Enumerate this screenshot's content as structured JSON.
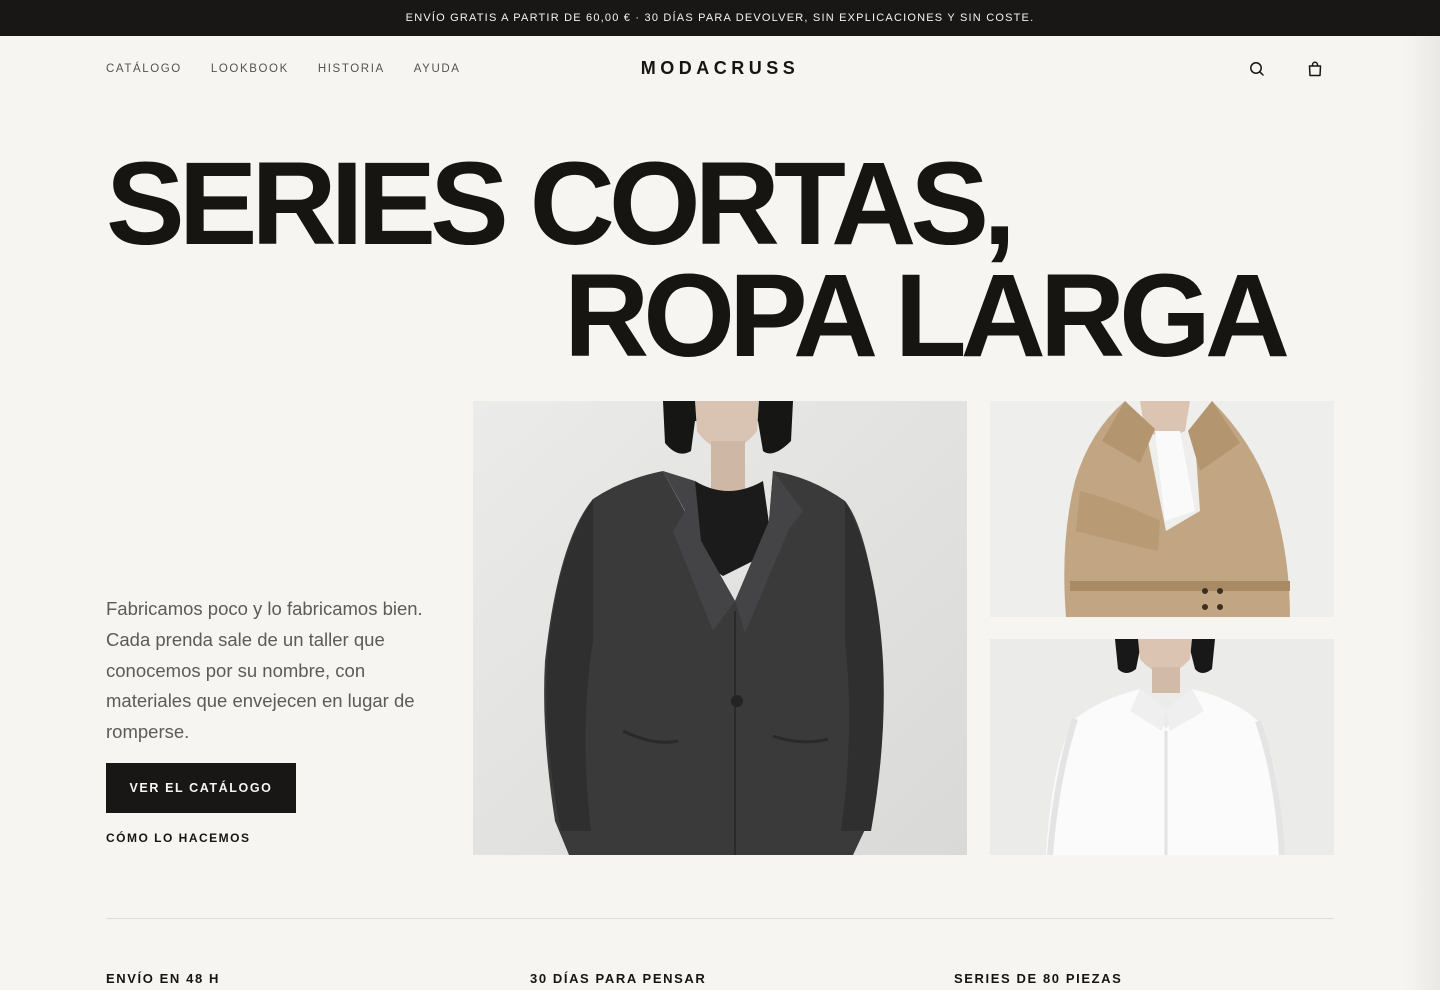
{
  "announcement": "ENVÍO GRATIS A PARTIR DE 60,00 € · 30 DÍAS PARA DEVOLVER, SIN EXPLICACIONES Y SIN COSTE.",
  "brand": "MODACRUSS",
  "nav": [
    {
      "label": "CATÁLOGO"
    },
    {
      "label": "LOOKBOOK"
    },
    {
      "label": "HISTORIA"
    },
    {
      "label": "AYUDA"
    }
  ],
  "header_icons": [
    "search-icon",
    "bag-icon"
  ],
  "hero": {
    "line1": "SERIES CORTAS,",
    "line2": "ROPA LARGA",
    "intro": "Fabricamos poco y lo fabricamos bien. Cada prenda sale de un taller que conocemos por su nombre, con materiales que envejecen en lugar de romperse.",
    "cta": "VER EL CATÁLOGO",
    "secondary_link": "CÓMO LO HACEMOS"
  },
  "images": [
    {
      "name": "charcoal-wool-coat-photo"
    },
    {
      "name": "beige-trench-coat-photo"
    },
    {
      "name": "white-shirt-photo"
    }
  ],
  "features": [
    {
      "title": "ENVÍO EN 48 H"
    },
    {
      "title": "30 DÍAS PARA PENSAR"
    },
    {
      "title": "SERIES DE 80 PIEZAS"
    }
  ],
  "colors": {
    "background": "#f6f5f1",
    "ink": "#161512",
    "announcement_bg": "#181715"
  }
}
